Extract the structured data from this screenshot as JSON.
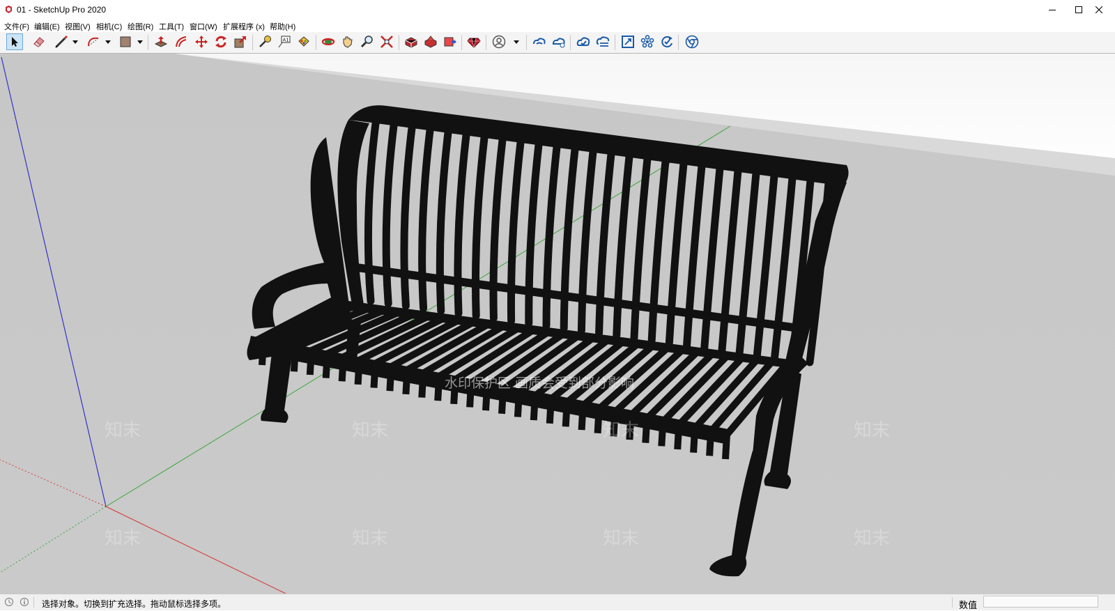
{
  "window": {
    "title": "01 - SketchUp Pro 2020",
    "app_icon": "sketchup-logo-icon",
    "controls": [
      "minimize-icon",
      "maximize-icon",
      "close-icon"
    ]
  },
  "menu": [
    {
      "label": "文件(F)"
    },
    {
      "label": "编辑(E)"
    },
    {
      "label": "视图(V)"
    },
    {
      "label": "相机(C)"
    },
    {
      "label": "绘图(R)"
    },
    {
      "label": "工具(T)"
    },
    {
      "label": "窗口(W)"
    },
    {
      "label": "扩展程序 (x)"
    },
    {
      "label": "帮助(H)"
    }
  ],
  "toolbar": {
    "tools": [
      "select-icon",
      "eraser-icon",
      "line-icon",
      "arc-icon",
      "rectangle-icon",
      "push-pull-icon",
      "offset-icon",
      "move-icon",
      "rotate-icon",
      "scale-icon",
      "tape-measure-icon",
      "text-icon",
      "paint-bucket-icon",
      "orbit-icon",
      "pan-icon",
      "zoom-icon",
      "zoom-extents-icon",
      "3d-warehouse-icon",
      "extension-warehouse-icon",
      "send-to-layout-icon",
      "ruby-console-icon",
      "account-icon",
      "trimble-connect-icon",
      "trimble-connect-share-icon",
      "cloud-upload-icon",
      "cloud-sync-icon",
      "scene-frame-icon",
      "components-icon",
      "refresh-icon",
      "chrome-icon"
    ]
  },
  "viewport": {
    "model": "metal-slatted-bench",
    "watermark": {
      "banner": "水印保护区 画质会受到部分影响",
      "tile_text": "知末"
    },
    "colors": {
      "sky": "#ffffff",
      "ground": "#c6c6c6",
      "bench": "#111111",
      "axis_red": "#d63434",
      "axis_green": "#3aa53a",
      "axis_blue": "#3434c8"
    }
  },
  "status": {
    "message": "选择对象。切换到扩充选择。拖动鼠标选择多项。",
    "measurements_label": "数值",
    "measurements_value": ""
  }
}
